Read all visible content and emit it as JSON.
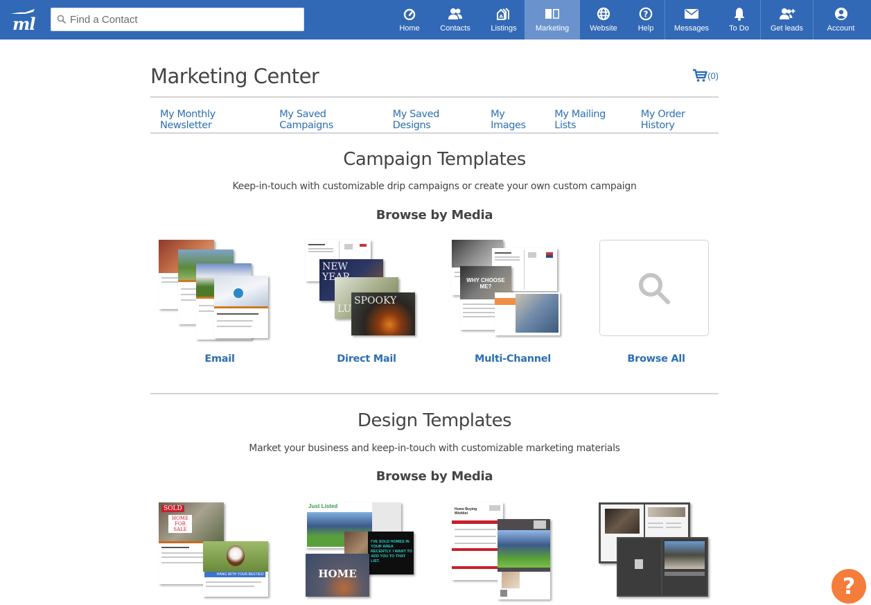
{
  "app": {
    "logo_text": "ml"
  },
  "search": {
    "placeholder": "Find a Contact",
    "value": ""
  },
  "nav": {
    "items": [
      {
        "label": "Home",
        "icon": "dashboard-gauge-icon",
        "active": false
      },
      {
        "label": "Contacts",
        "icon": "contacts-people-icon",
        "active": false
      },
      {
        "label": "Listings",
        "icon": "listings-houses-icon",
        "active": false
      },
      {
        "label": "Marketing",
        "icon": "marketing-book-icon",
        "active": true
      },
      {
        "label": "Website",
        "icon": "globe-icon",
        "active": false
      },
      {
        "label": "Help",
        "icon": "help-circle-icon",
        "active": false
      },
      {
        "label": "Messages",
        "icon": "envelope-icon",
        "active": false
      },
      {
        "label": "To Do",
        "icon": "bell-icon",
        "active": false
      },
      {
        "label": "Get leads",
        "icon": "add-user-icon",
        "active": false
      },
      {
        "label": "Account",
        "icon": "account-circle-icon",
        "active": false
      }
    ]
  },
  "page": {
    "title": "Marketing Center",
    "cart_count": "(0)"
  },
  "subnav": {
    "links": [
      "My Monthly Newsletter",
      "My Saved Campaigns",
      "My Saved Designs",
      "My Images",
      "My Mailing Lists",
      "My Order History"
    ]
  },
  "campaign": {
    "title": "Campaign Templates",
    "subtitle": "Keep-in-touch with customizable drip campaigns or create your own custom campaign",
    "browse_heading": "Browse by Media",
    "tiles": [
      {
        "label": "Email"
      },
      {
        "label": "Direct Mail",
        "thumb_texts": [
          "NEW",
          "YEAR",
          "SPOOKY",
          "LU"
        ]
      },
      {
        "label": "Multi-Channel",
        "thumb_texts": [
          "WHY CHOOSE ME?"
        ]
      },
      {
        "label": "Browse All"
      }
    ]
  },
  "design": {
    "title": "Design Templates",
    "subtitle": "Market your business and keep-in-touch with customizable marketing materials",
    "browse_heading": "Browse by Media",
    "thumb_texts": {
      "sold": "SOLD",
      "home_for_sale": "HOME FOR SALE",
      "just_listed": "Just Listed",
      "sold_homes": "I'VE SOLD HOMES IN YOUR AREA RECENTLY. I WANT TO ADD YOU TO THAT LIST.",
      "home": "HOME",
      "wishlist": "Home Buying Wishlist",
      "hang": "HANG WITH YOUR BESTIES!"
    }
  },
  "help_fab": {
    "label": "?"
  },
  "colors": {
    "topbar": "#3269b6",
    "active_nav": "#6a93cd",
    "link": "#2c6fb3",
    "help_fab": "#f47d3b"
  }
}
